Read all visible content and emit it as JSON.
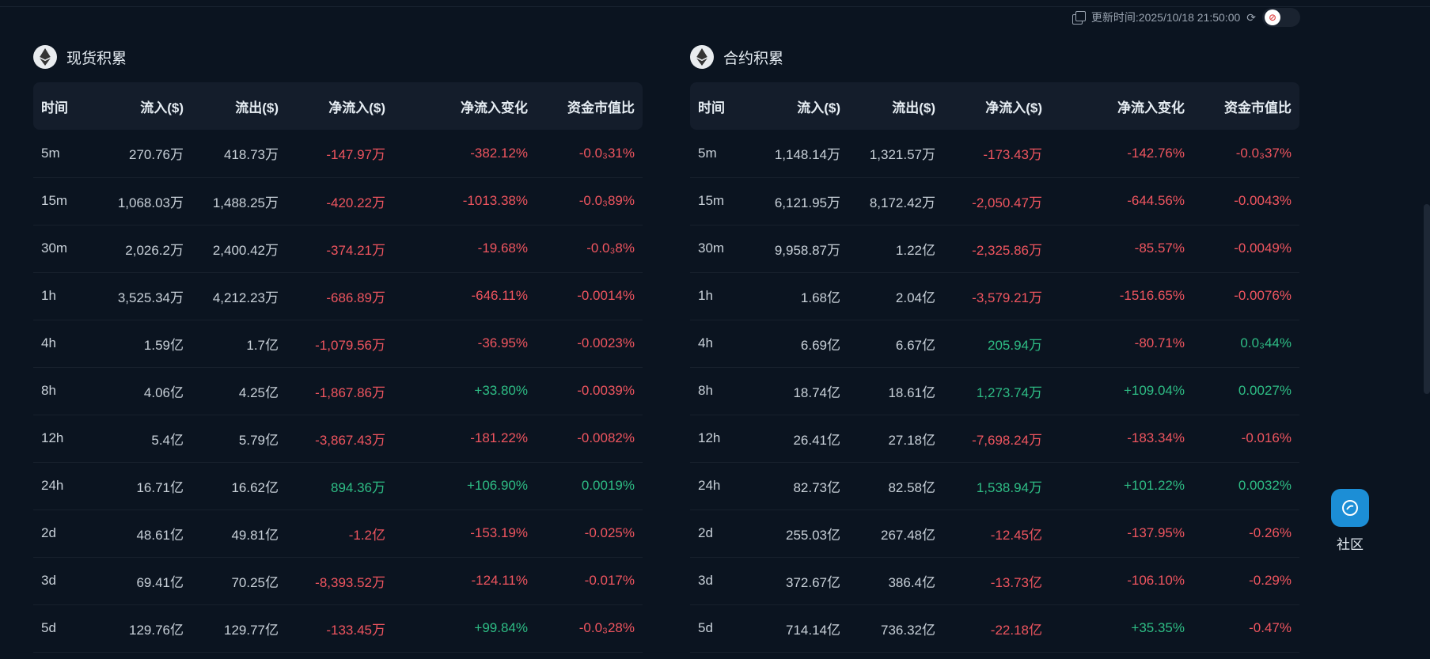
{
  "topbar": {
    "update_time": "更新时间:2025/10/18 21:50:00",
    "icons": [
      "copy-icon",
      "refresh-icon",
      "theme-toggle"
    ]
  },
  "colors": {
    "negative": "#f0555f",
    "positive": "#2ebd85",
    "background": "#0b1420",
    "header": "#141d2b"
  },
  "columns": [
    "时间",
    "流入($)",
    "流出($)",
    "净流入($)",
    "净流入变化",
    "资金市值比"
  ],
  "spot": {
    "title": "现货积累",
    "rows": [
      {
        "time": "5m",
        "inflow": "270.76万",
        "outflow": "418.73万",
        "net": "-147.97万",
        "change": "-382.12%",
        "ratio": "-0.0₃31%",
        "net_sign": "neg",
        "change_sign": "neg",
        "ratio_sign": "neg"
      },
      {
        "time": "15m",
        "inflow": "1,068.03万",
        "outflow": "1,488.25万",
        "net": "-420.22万",
        "change": "-1013.38%",
        "ratio": "-0.0₃89%",
        "net_sign": "neg",
        "change_sign": "neg",
        "ratio_sign": "neg"
      },
      {
        "time": "30m",
        "inflow": "2,026.2万",
        "outflow": "2,400.42万",
        "net": "-374.21万",
        "change": "-19.68%",
        "ratio": "-0.0₃8%",
        "net_sign": "neg",
        "change_sign": "neg",
        "ratio_sign": "neg"
      },
      {
        "time": "1h",
        "inflow": "3,525.34万",
        "outflow": "4,212.23万",
        "net": "-686.89万",
        "change": "-646.11%",
        "ratio": "-0.0014%",
        "net_sign": "neg",
        "change_sign": "neg",
        "ratio_sign": "neg"
      },
      {
        "time": "4h",
        "inflow": "1.59亿",
        "outflow": "1.7亿",
        "net": "-1,079.56万",
        "change": "-36.95%",
        "ratio": "-0.0023%",
        "net_sign": "neg",
        "change_sign": "neg",
        "ratio_sign": "neg"
      },
      {
        "time": "8h",
        "inflow": "4.06亿",
        "outflow": "4.25亿",
        "net": "-1,867.86万",
        "change": "+33.80%",
        "ratio": "-0.0039%",
        "net_sign": "neg",
        "change_sign": "pos",
        "ratio_sign": "neg"
      },
      {
        "time": "12h",
        "inflow": "5.4亿",
        "outflow": "5.79亿",
        "net": "-3,867.43万",
        "change": "-181.22%",
        "ratio": "-0.0082%",
        "net_sign": "neg",
        "change_sign": "neg",
        "ratio_sign": "neg"
      },
      {
        "time": "24h",
        "inflow": "16.71亿",
        "outflow": "16.62亿",
        "net": "894.36万",
        "change": "+106.90%",
        "ratio": "0.0019%",
        "net_sign": "pos",
        "change_sign": "pos",
        "ratio_sign": "pos"
      },
      {
        "time": "2d",
        "inflow": "48.61亿",
        "outflow": "49.81亿",
        "net": "-1.2亿",
        "change": "-153.19%",
        "ratio": "-0.025%",
        "net_sign": "neg",
        "change_sign": "neg",
        "ratio_sign": "neg"
      },
      {
        "time": "3d",
        "inflow": "69.41亿",
        "outflow": "70.25亿",
        "net": "-8,393.52万",
        "change": "-124.11%",
        "ratio": "-0.017%",
        "net_sign": "neg",
        "change_sign": "neg",
        "ratio_sign": "neg"
      },
      {
        "time": "5d",
        "inflow": "129.76亿",
        "outflow": "129.77亿",
        "net": "-133.45万",
        "change": "+99.84%",
        "ratio": "-0.0₃28%",
        "net_sign": "neg",
        "change_sign": "pos",
        "ratio_sign": "neg"
      }
    ]
  },
  "futures": {
    "title": "合约积累",
    "rows": [
      {
        "time": "5m",
        "inflow": "1,148.14万",
        "outflow": "1,321.57万",
        "net": "-173.43万",
        "change": "-142.76%",
        "ratio": "-0.0₃37%",
        "net_sign": "neg",
        "change_sign": "neg",
        "ratio_sign": "neg"
      },
      {
        "time": "15m",
        "inflow": "6,121.95万",
        "outflow": "8,172.42万",
        "net": "-2,050.47万",
        "change": "-644.56%",
        "ratio": "-0.0043%",
        "net_sign": "neg",
        "change_sign": "neg",
        "ratio_sign": "neg"
      },
      {
        "time": "30m",
        "inflow": "9,958.87万",
        "outflow": "1.22亿",
        "net": "-2,325.86万",
        "change": "-85.57%",
        "ratio": "-0.0049%",
        "net_sign": "neg",
        "change_sign": "neg",
        "ratio_sign": "neg"
      },
      {
        "time": "1h",
        "inflow": "1.68亿",
        "outflow": "2.04亿",
        "net": "-3,579.21万",
        "change": "-1516.65%",
        "ratio": "-0.0076%",
        "net_sign": "neg",
        "change_sign": "neg",
        "ratio_sign": "neg"
      },
      {
        "time": "4h",
        "inflow": "6.69亿",
        "outflow": "6.67亿",
        "net": "205.94万",
        "change": "-80.71%",
        "ratio": "0.0₃44%",
        "net_sign": "pos",
        "change_sign": "neg",
        "ratio_sign": "pos"
      },
      {
        "time": "8h",
        "inflow": "18.74亿",
        "outflow": "18.61亿",
        "net": "1,273.74万",
        "change": "+109.04%",
        "ratio": "0.0027%",
        "net_sign": "pos",
        "change_sign": "pos",
        "ratio_sign": "pos"
      },
      {
        "time": "12h",
        "inflow": "26.41亿",
        "outflow": "27.18亿",
        "net": "-7,698.24万",
        "change": "-183.34%",
        "ratio": "-0.016%",
        "net_sign": "neg",
        "change_sign": "neg",
        "ratio_sign": "neg"
      },
      {
        "time": "24h",
        "inflow": "82.73亿",
        "outflow": "82.58亿",
        "net": "1,538.94万",
        "change": "+101.22%",
        "ratio": "0.0032%",
        "net_sign": "pos",
        "change_sign": "pos",
        "ratio_sign": "pos"
      },
      {
        "time": "2d",
        "inflow": "255.03亿",
        "outflow": "267.48亿",
        "net": "-12.45亿",
        "change": "-137.95%",
        "ratio": "-0.26%",
        "net_sign": "neg",
        "change_sign": "neg",
        "ratio_sign": "neg"
      },
      {
        "time": "3d",
        "inflow": "372.67亿",
        "outflow": "386.4亿",
        "net": "-13.73亿",
        "change": "-106.10%",
        "ratio": "-0.29%",
        "net_sign": "neg",
        "change_sign": "neg",
        "ratio_sign": "neg"
      },
      {
        "time": "5d",
        "inflow": "714.14亿",
        "outflow": "736.32亿",
        "net": "-22.18亿",
        "change": "+35.35%",
        "ratio": "-0.47%",
        "net_sign": "neg",
        "change_sign": "pos",
        "ratio_sign": "neg"
      }
    ]
  },
  "community": {
    "label": "社区"
  }
}
